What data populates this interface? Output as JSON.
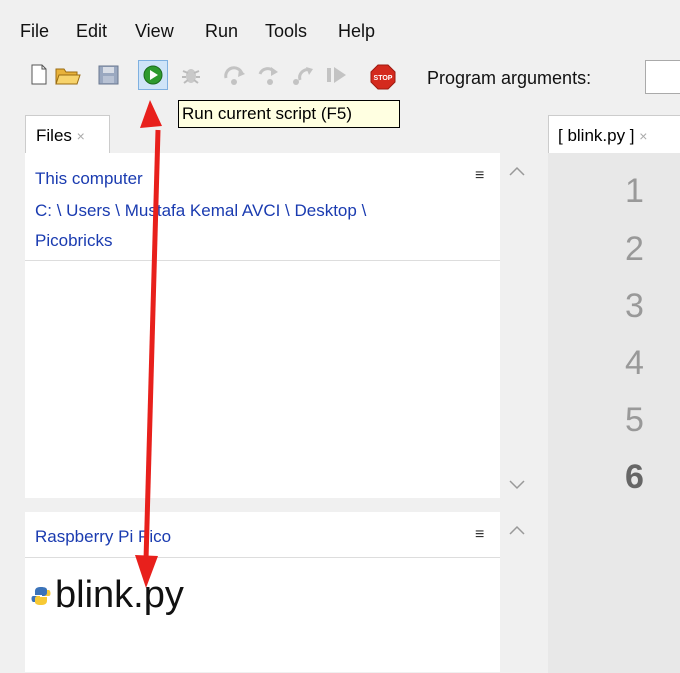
{
  "menu": [
    "File",
    "Edit",
    "View",
    "Run",
    "Tools",
    "Help"
  ],
  "toolbar": {
    "icons": [
      "new-file-icon",
      "open-folder-icon",
      "save-icon",
      "run-icon",
      "debug-icon",
      "step-over-icon",
      "step-into-icon",
      "step-out-icon",
      "resume-icon",
      "stop-icon"
    ],
    "program_arguments_label": "Program arguments:",
    "tooltip": "Run current script (F5)"
  },
  "files_tab": {
    "label": "Files",
    "close": "×"
  },
  "this_computer": {
    "title": "This computer",
    "path": "C: \\ Users \\ Mustafa Kemal AVCI \\ Desktop \\",
    "path2": "Picobricks"
  },
  "pico": {
    "title": "Raspberry Pi Pico",
    "file": "blink.py"
  },
  "editor_tab": {
    "label": "[ blink.py ]",
    "close": "×"
  },
  "line_numbers": [
    "1",
    "2",
    "3",
    "4",
    "5",
    "6"
  ],
  "colors": {
    "annotation_arrow": "#e8201c",
    "link_blue": "#1a3bb0",
    "run_green": "#2e9a2e",
    "stop_red": "#d42a1e"
  }
}
